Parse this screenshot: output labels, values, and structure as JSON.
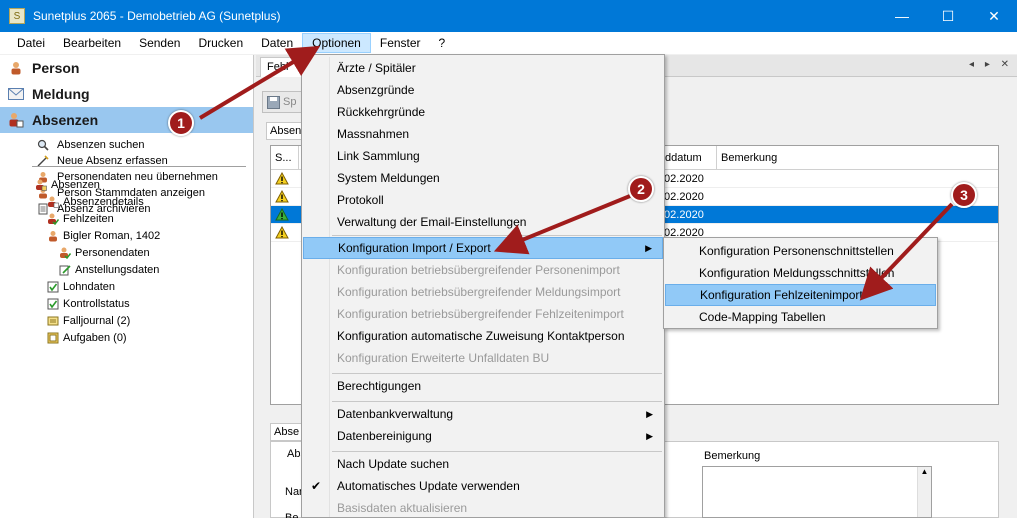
{
  "window": {
    "title": "Sunetplus 2065 - Demobetrieb AG (Sunetplus)",
    "minimize_glyph": "—",
    "maximize_glyph": "☐",
    "close_glyph": "✕"
  },
  "menubar": {
    "items": [
      "Datei",
      "Bearbeiten",
      "Senden",
      "Drucken",
      "Daten",
      "Optionen",
      "Fenster",
      "?"
    ],
    "active": "Optionen"
  },
  "sidebar": {
    "sections": [
      {
        "label": "Person",
        "icon": "person-icon"
      },
      {
        "label": "Meldung",
        "icon": "envelope-icon"
      },
      {
        "label": "Absenzen",
        "icon": "absence-icon"
      }
    ],
    "actions": [
      "Absenzen suchen",
      "Neue Absenz erfassen",
      "Personendaten neu übernehmen",
      "Person Stammdaten anzeigen",
      "Absenz archivieren"
    ],
    "tree": [
      {
        "label": "Absenzen",
        "indent": 0
      },
      {
        "label": "Absenzendetails",
        "indent": 1
      },
      {
        "label": "Fehlzeiten",
        "indent": 1
      },
      {
        "label": "Bigler Roman, 1402",
        "indent": 1
      },
      {
        "label": "Personendaten",
        "indent": 2
      },
      {
        "label": "Anstellungsdaten",
        "indent": 2
      },
      {
        "label": "Lohndaten",
        "indent": 1
      },
      {
        "label": "Kontrollstatus",
        "indent": 1
      },
      {
        "label": "Falljournal (2)",
        "indent": 1
      },
      {
        "label": "Aufgaben (0)",
        "indent": 1
      }
    ]
  },
  "content": {
    "tab_label": "Fehl",
    "tab_nav": "◂ ▸ ✕",
    "toolbar_label": "Sp",
    "group_tab": "Absen",
    "grid": {
      "headers": [
        "S...",
        "ddatum",
        "Bemerkung"
      ],
      "rows": [
        {
          "date": ".02.2020",
          "selected": false
        },
        {
          "date": ".02.2020",
          "selected": false
        },
        {
          "date": ".02.2020",
          "selected": true
        },
        {
          "date": ".02.2020",
          "selected": false
        }
      ]
    },
    "lower_tab": "Abse",
    "lower_group": "Abs",
    "field_prefix_1": "Nar",
    "field_prefix_2": "Be",
    "bemerkung_label": "Bemerkung"
  },
  "options_menu": {
    "items": [
      {
        "label": "Ärzte / Spitäler",
        "state": "normal"
      },
      {
        "label": "Absenzgründe",
        "state": "normal"
      },
      {
        "label": "Rückkehrgründe",
        "state": "normal"
      },
      {
        "label": "Massnahmen",
        "state": "normal"
      },
      {
        "label": "Link Sammlung",
        "state": "normal"
      },
      {
        "label": "System Meldungen",
        "state": "normal"
      },
      {
        "label": "Protokoll",
        "state": "normal"
      },
      {
        "label": "Verwaltung der Email-Einstellungen",
        "state": "normal"
      },
      {
        "label": "Konfiguration Import / Export",
        "state": "highlighted",
        "submenu": true
      },
      {
        "label": "Konfiguration betriebsübergreifender Personenimport",
        "state": "disabled"
      },
      {
        "label": "Konfiguration betriebsübergreifender Meldungsimport",
        "state": "disabled"
      },
      {
        "label": "Konfiguration betriebsübergreifender Fehlzeitenimport",
        "state": "disabled"
      },
      {
        "label": "Konfiguration automatische Zuweisung Kontaktperson",
        "state": "normal"
      },
      {
        "label": "Konfiguration Erweiterte Unfalldaten BU",
        "state": "disabled"
      },
      {
        "label": "Berechtigungen",
        "state": "normal"
      },
      {
        "label": "Datenbankverwaltung",
        "state": "normal",
        "submenu": true
      },
      {
        "label": "Datenbereinigung",
        "state": "normal",
        "submenu": true
      },
      {
        "label": "Nach Update suchen",
        "state": "normal"
      },
      {
        "label": "Automatisches Update verwenden",
        "state": "checked"
      },
      {
        "label": "Basisdaten aktualisieren",
        "state": "disabled"
      }
    ]
  },
  "import_export_submenu": {
    "items": [
      {
        "label": "Konfiguration Personenschnittstellen",
        "state": "normal"
      },
      {
        "label": "Konfiguration Meldungsschnittstellen",
        "state": "normal"
      },
      {
        "label": "Konfiguration Fehlzeitenimport",
        "state": "highlighted"
      },
      {
        "label": "Code-Mapping Tabellen",
        "state": "normal"
      }
    ]
  },
  "annotations": {
    "badges": [
      "1",
      "2",
      "3"
    ],
    "arrow_color": "#a01c1c"
  },
  "colors": {
    "titlebar": "#0078d7",
    "highlight": "#91c9f7",
    "selection": "#0078d7",
    "sidebar_active": "#99c7ef"
  }
}
